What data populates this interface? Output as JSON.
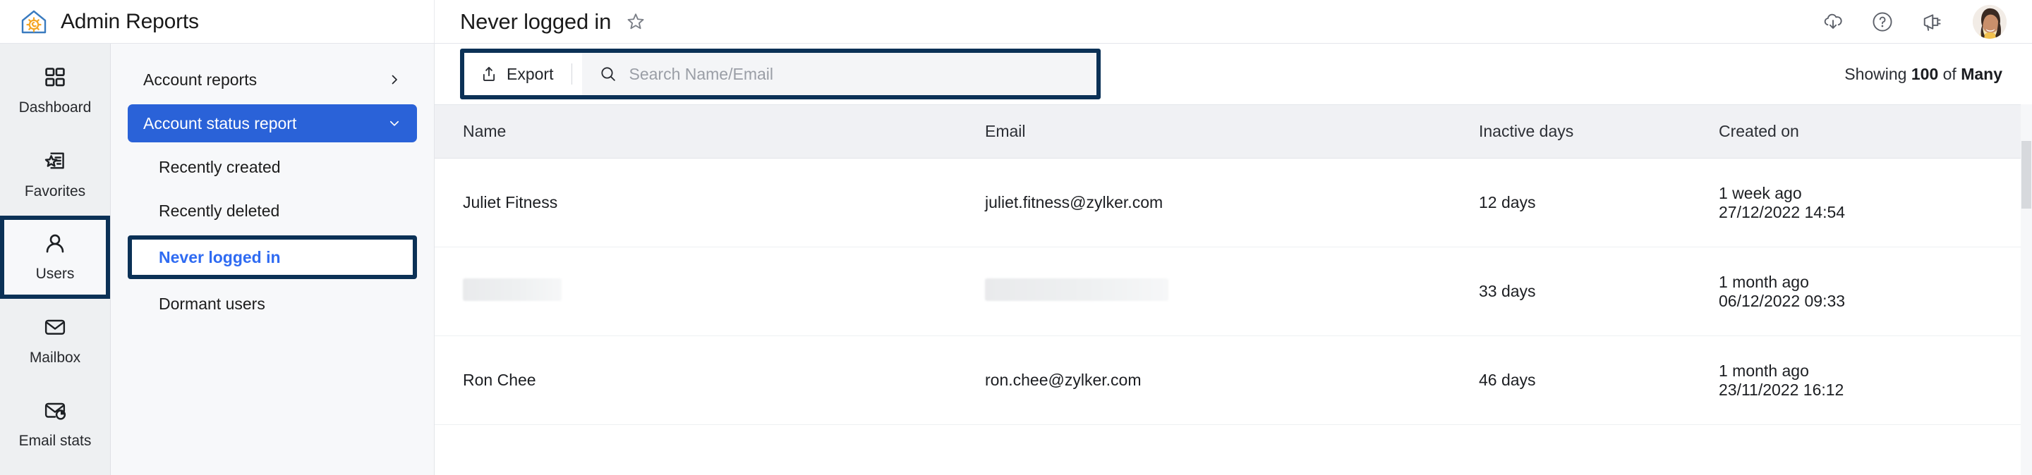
{
  "app": {
    "brand_title": "Admin Reports",
    "logo_icon": "house-gear-icon"
  },
  "header": {
    "page_title": "Never logged in",
    "favorite_icon": "star-outline-icon",
    "actions": [
      {
        "name": "download-cloud-icon",
        "label": "Download"
      },
      {
        "name": "help-circle-icon",
        "label": "Help"
      },
      {
        "name": "megaphone-icon",
        "label": "Announcements"
      }
    ],
    "avatar": {
      "name": "user-avatar",
      "alt": "Profile photo"
    }
  },
  "rail": {
    "items": [
      {
        "label": "Dashboard",
        "icon": "grid-squares-icon",
        "selected": false
      },
      {
        "label": "Favorites",
        "icon": "star-document-icon",
        "selected": false
      },
      {
        "label": "Users",
        "icon": "person-icon",
        "selected": true
      },
      {
        "label": "Mailbox",
        "icon": "envelope-icon",
        "selected": false
      },
      {
        "label": "Email stats",
        "icon": "envelope-chart-icon",
        "selected": false
      }
    ]
  },
  "subnav": {
    "groups": [
      {
        "label": "Account reports",
        "state": "collapsed",
        "chevron": "chevron-right-icon",
        "active": false,
        "children": []
      },
      {
        "label": "Account status report",
        "state": "expanded",
        "chevron": "chevron-down-icon",
        "active": true,
        "children": [
          {
            "label": "Recently created",
            "current": false
          },
          {
            "label": "Recently deleted",
            "current": false
          },
          {
            "label": "Never logged in",
            "current": true
          },
          {
            "label": "Dormant users",
            "current": false
          }
        ]
      }
    ]
  },
  "toolbar": {
    "export_label": "Export",
    "export_icon": "upload-share-icon",
    "search_icon": "search-icon",
    "search_placeholder": "Search Name/Email",
    "search_value": "",
    "showing_prefix": "Showing ",
    "showing_count": "100",
    "showing_middle": " of ",
    "showing_total": "Many"
  },
  "table": {
    "columns": [
      "Name",
      "Email",
      "Inactive days",
      "Created on"
    ],
    "rows": [
      {
        "name": "Juliet Fitness",
        "name_redacted": false,
        "email": "juliet.fitness@zylker.com",
        "email_redacted": false,
        "inactive_days": "12 days",
        "created_relative": "1 week ago",
        "created_absolute": "27/12/2022 14:54"
      },
      {
        "name": "",
        "name_redacted": true,
        "email": "",
        "email_redacted": true,
        "inactive_days": "33 days",
        "created_relative": "1 month ago",
        "created_absolute": "06/12/2022 09:33"
      },
      {
        "name": "Ron Chee",
        "name_redacted": false,
        "email": "ron.chee@zylker.com",
        "email_redacted": false,
        "inactive_days": "46 days",
        "created_relative": "1 month ago",
        "created_absolute": "23/11/2022 16:12"
      }
    ]
  },
  "colors": {
    "accent_blue": "#2a62d8",
    "link_blue": "#2f6bf2",
    "highlight_outline": "#0b3156",
    "rail_bg": "#eef0f2",
    "subnav_bg": "#f7f8fa",
    "table_head_bg": "#f0f1f4",
    "logo_blue": "#3a7bbf",
    "logo_orange": "#f5a623"
  }
}
